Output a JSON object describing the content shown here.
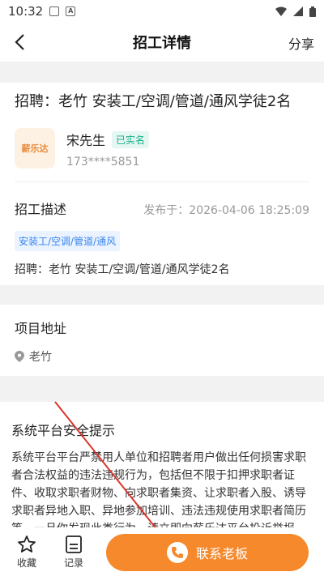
{
  "status_bar": {
    "time": "10:32"
  },
  "header": {
    "title": "招工详情",
    "share_label": "分享"
  },
  "job": {
    "title": "招聘：老竹 安装工/空调/管道/通风学徒2名",
    "company_logo_text": "薪乐达",
    "contact_name": "宋先生",
    "verified_label": "已实名",
    "phone": "173****5851"
  },
  "description": {
    "label": "招工描述",
    "published": "发布于：2026-04-06 18:25:09",
    "tag": "安装工/空调/管道/通风",
    "body": "招聘：老竹 安装工/空调/管道/通风学徒2名"
  },
  "address": {
    "label": "项目地址",
    "value": "老竹"
  },
  "safety": {
    "label": "系统平台安全提示",
    "text": "系统平台平台严禁用人单位和招聘者用户做出任何损害求职者合法权益的违法违规行为，包括但不限于扣押求职者证件、收取求职者财物、向求职者集资、让求职者入股、诱导求职者异地入职、异地参加培训、违法违规使用求职者简历等。一旦你发现此类行为，请立即向薪乐达平台投诉举报。"
  },
  "bottom_bar": {
    "favorite_label": "收藏",
    "records_label": "记录",
    "cta_label": "联系老板"
  },
  "colors": {
    "accent": "#f5892b",
    "verified": "#17b08a",
    "link": "#3a86ee"
  }
}
